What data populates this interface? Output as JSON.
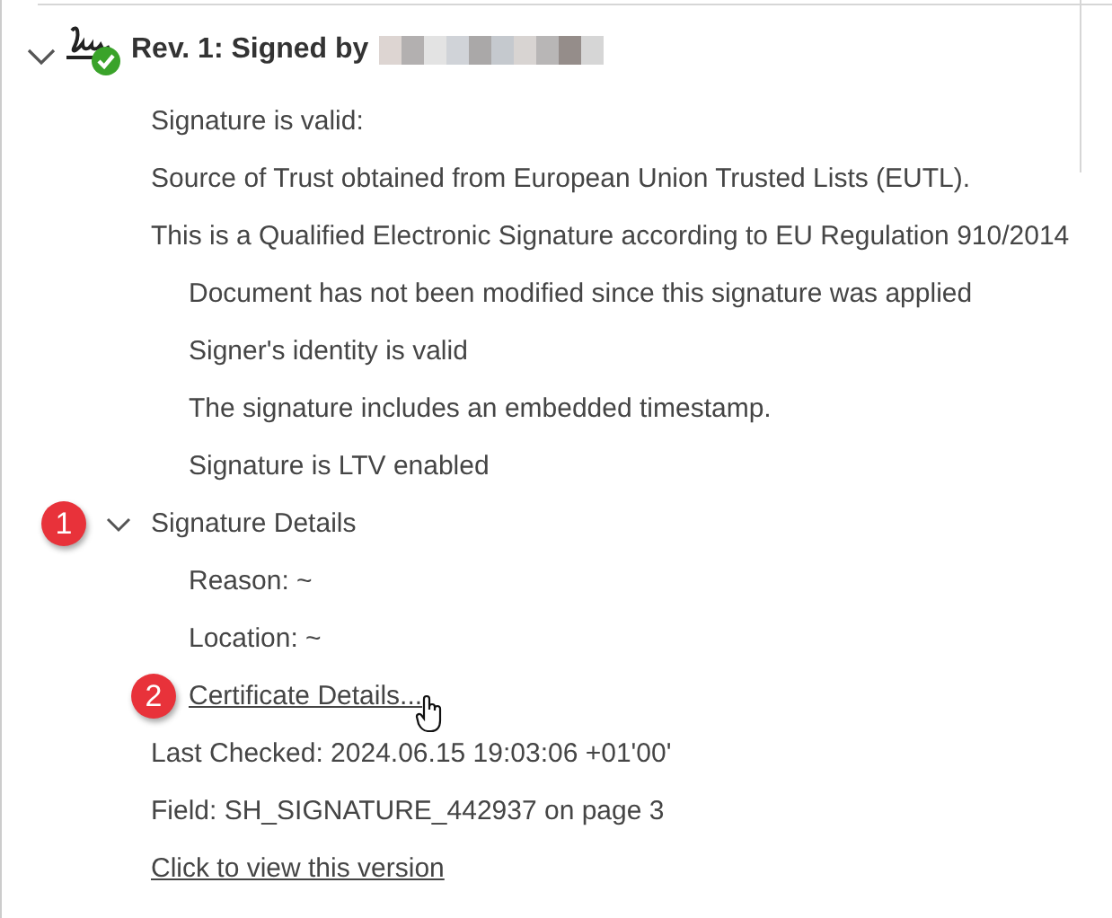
{
  "header": {
    "title": "Rev. 1: Signed by",
    "expanded": true
  },
  "tree": [
    {
      "kind": "text",
      "text": "Signature is valid:"
    },
    {
      "kind": "text",
      "text": "Source of Trust obtained from European Union Trusted Lists (EUTL)."
    },
    {
      "kind": "text",
      "text": "This is a Qualified Electronic Signature according to EU Regulation 910/2014",
      "children": [
        {
          "kind": "text",
          "text": "Document has not been modified since this signature was applied"
        },
        {
          "kind": "text",
          "text": "Signer's identity is valid"
        },
        {
          "kind": "text",
          "text": "The signature includes an embedded timestamp."
        },
        {
          "kind": "text",
          "text": "Signature is LTV enabled"
        }
      ]
    },
    {
      "kind": "group",
      "text": "Signature Details",
      "expanded": true,
      "callout": "1",
      "children": [
        {
          "kind": "text",
          "text": "Reason: ~"
        },
        {
          "kind": "text",
          "text": "Location: ~"
        },
        {
          "kind": "link",
          "text": "Certificate Details...",
          "callout": "2",
          "hover": true
        }
      ]
    },
    {
      "kind": "text",
      "text": "Last Checked: 2024.06.15 19:03:06 +01'00'"
    },
    {
      "kind": "text",
      "text": "Field: SH_SIGNATURE_442937 on page 3"
    },
    {
      "kind": "link",
      "text": "Click to view this version"
    }
  ]
}
